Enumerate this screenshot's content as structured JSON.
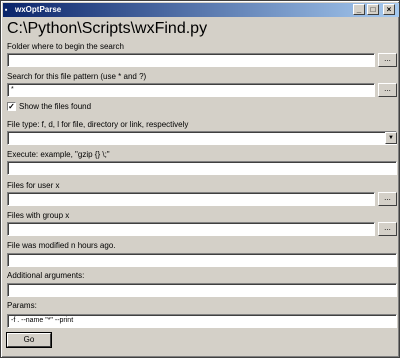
{
  "window": {
    "title": "wxOptParse",
    "minimize": "_",
    "maximize": "□",
    "close": "×",
    "app_icon": "python-icon"
  },
  "heading": "C:\\Python\\Scripts\\wxFind.py",
  "fields": {
    "folder": {
      "label": "Folder where to begin the search",
      "value": "",
      "browse": "..."
    },
    "pattern": {
      "label": "Search for this file pattern (use * and ?)",
      "value": "*",
      "browse": "..."
    },
    "show_files": {
      "label": "Show the files found",
      "checked": true
    },
    "file_type": {
      "label": "File type: f, d, l for file, directory or link, respectively",
      "value": ""
    },
    "execute": {
      "label": "Execute: example, \"gzip {} \\;\"",
      "value": ""
    },
    "user": {
      "label": "Files for user x",
      "value": "",
      "browse": "..."
    },
    "group": {
      "label": "Files with group x",
      "value": "",
      "browse": "..."
    },
    "modified": {
      "label": "File was modified n hours ago.",
      "value": ""
    },
    "additional": {
      "label": "Additional arguments:",
      "value": ""
    },
    "params": {
      "label": "Params:",
      "value": "-f . --name \"*\" --print"
    }
  },
  "go_button": "Go"
}
